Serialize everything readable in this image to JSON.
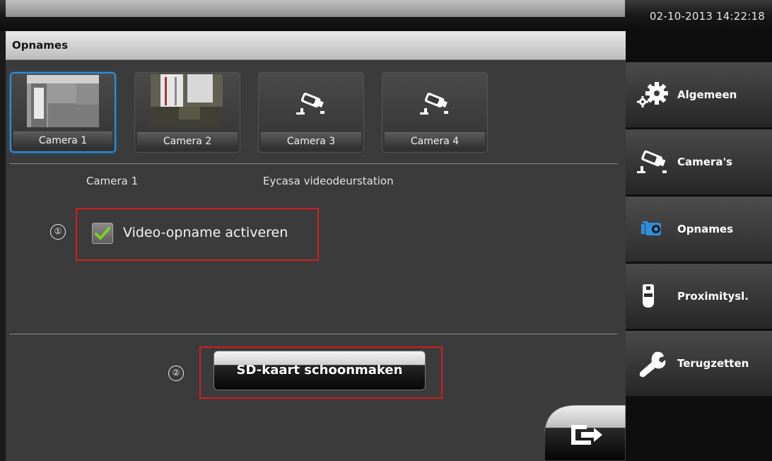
{
  "status_bar": {
    "datetime": "02-10-2013 14:22:18"
  },
  "page": {
    "title": "Opnames"
  },
  "cameras": [
    {
      "label": "Camera 1",
      "selected": true,
      "has_preview": true
    },
    {
      "label": "Camera 2",
      "selected": false,
      "has_preview": true
    },
    {
      "label": "Camera 3",
      "selected": false,
      "has_preview": false,
      "icon": "security-camera-icon"
    },
    {
      "label": "Camera 4",
      "selected": false,
      "has_preview": false,
      "icon": "security-camera-icon"
    }
  ],
  "selected_camera": {
    "name": "Camera 1",
    "description": "Eycasa videodeurstation"
  },
  "video_recording": {
    "marker": "①",
    "label": "Video-opname activeren",
    "checked": true
  },
  "sd_card": {
    "marker": "②",
    "button_label": "SD-kaart schoonmaken"
  },
  "sidebar": {
    "items": [
      {
        "label": "Algemeen",
        "icon": "gears-icon",
        "active": false
      },
      {
        "label": "Camera's",
        "icon": "security-camera-icon",
        "active": false
      },
      {
        "label": "Opnames",
        "icon": "camcorder-icon",
        "active": true
      },
      {
        "label": "Proximitysl.",
        "icon": "key-tag-icon",
        "active": false
      },
      {
        "label": "Terugzetten",
        "icon": "wrench-icon",
        "active": false
      }
    ]
  },
  "colors": {
    "accent": "#2f8fd9",
    "highlight": "#d61d1d",
    "check": "#7ed321"
  }
}
